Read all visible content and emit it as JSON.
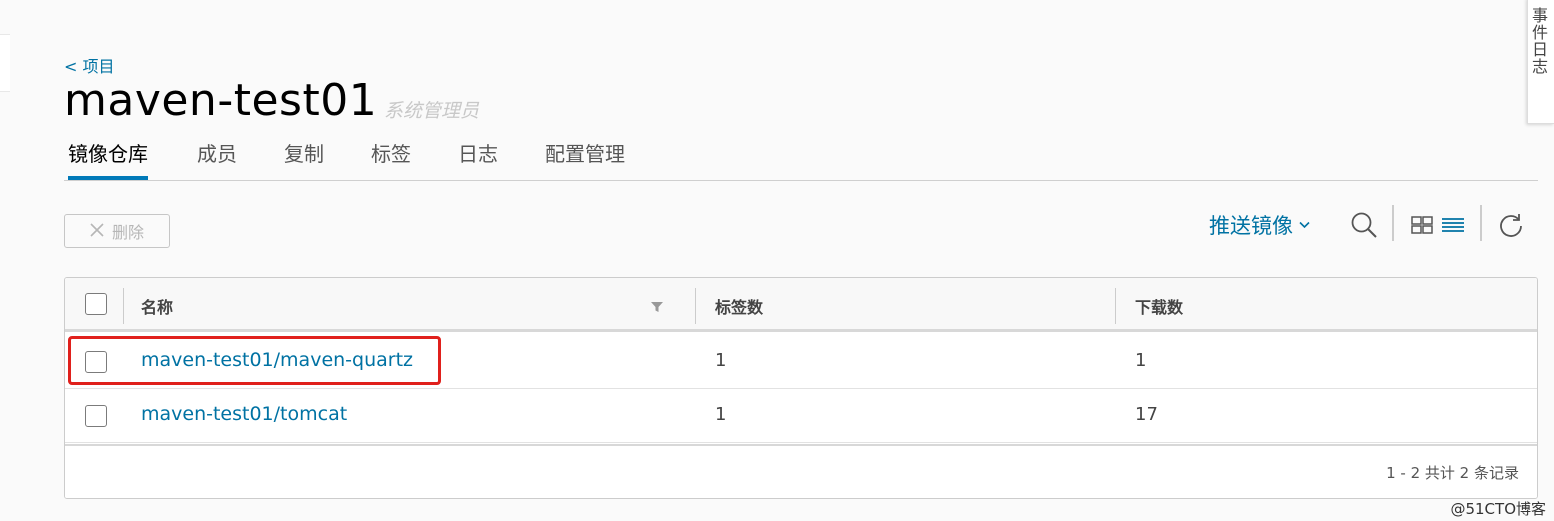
{
  "breadcrumb": {
    "back_label": "< 项目"
  },
  "project": {
    "title": "maven-test01",
    "role": "系统管理员"
  },
  "side_panel": {
    "label": "事件日志"
  },
  "tabs": [
    {
      "label": "镜像仓库",
      "active": true
    },
    {
      "label": "成员"
    },
    {
      "label": "复制"
    },
    {
      "label": "标签"
    },
    {
      "label": "日志"
    },
    {
      "label": "配置管理"
    }
  ],
  "toolbar": {
    "delete_label": "删除",
    "push_label": "推送镜像",
    "icons": [
      "close-icon",
      "chevron-down-icon",
      "search-icon",
      "grid-view-icon",
      "list-view-icon",
      "refresh-icon"
    ]
  },
  "table": {
    "columns": [
      "名称",
      "标签数",
      "下载数"
    ],
    "rows": [
      {
        "name": "maven-test01/maven-quartz",
        "tags": "1",
        "pulls": "1"
      },
      {
        "name": "maven-test01/tomcat",
        "tags": "1",
        "pulls": "17"
      }
    ],
    "pagination": "1 - 2 共计 2 条记录"
  },
  "watermark": "@51CTO博客",
  "colors": {
    "accent": "#0072a3",
    "active_tab": "#0079b8",
    "highlight": "#e0201c"
  }
}
